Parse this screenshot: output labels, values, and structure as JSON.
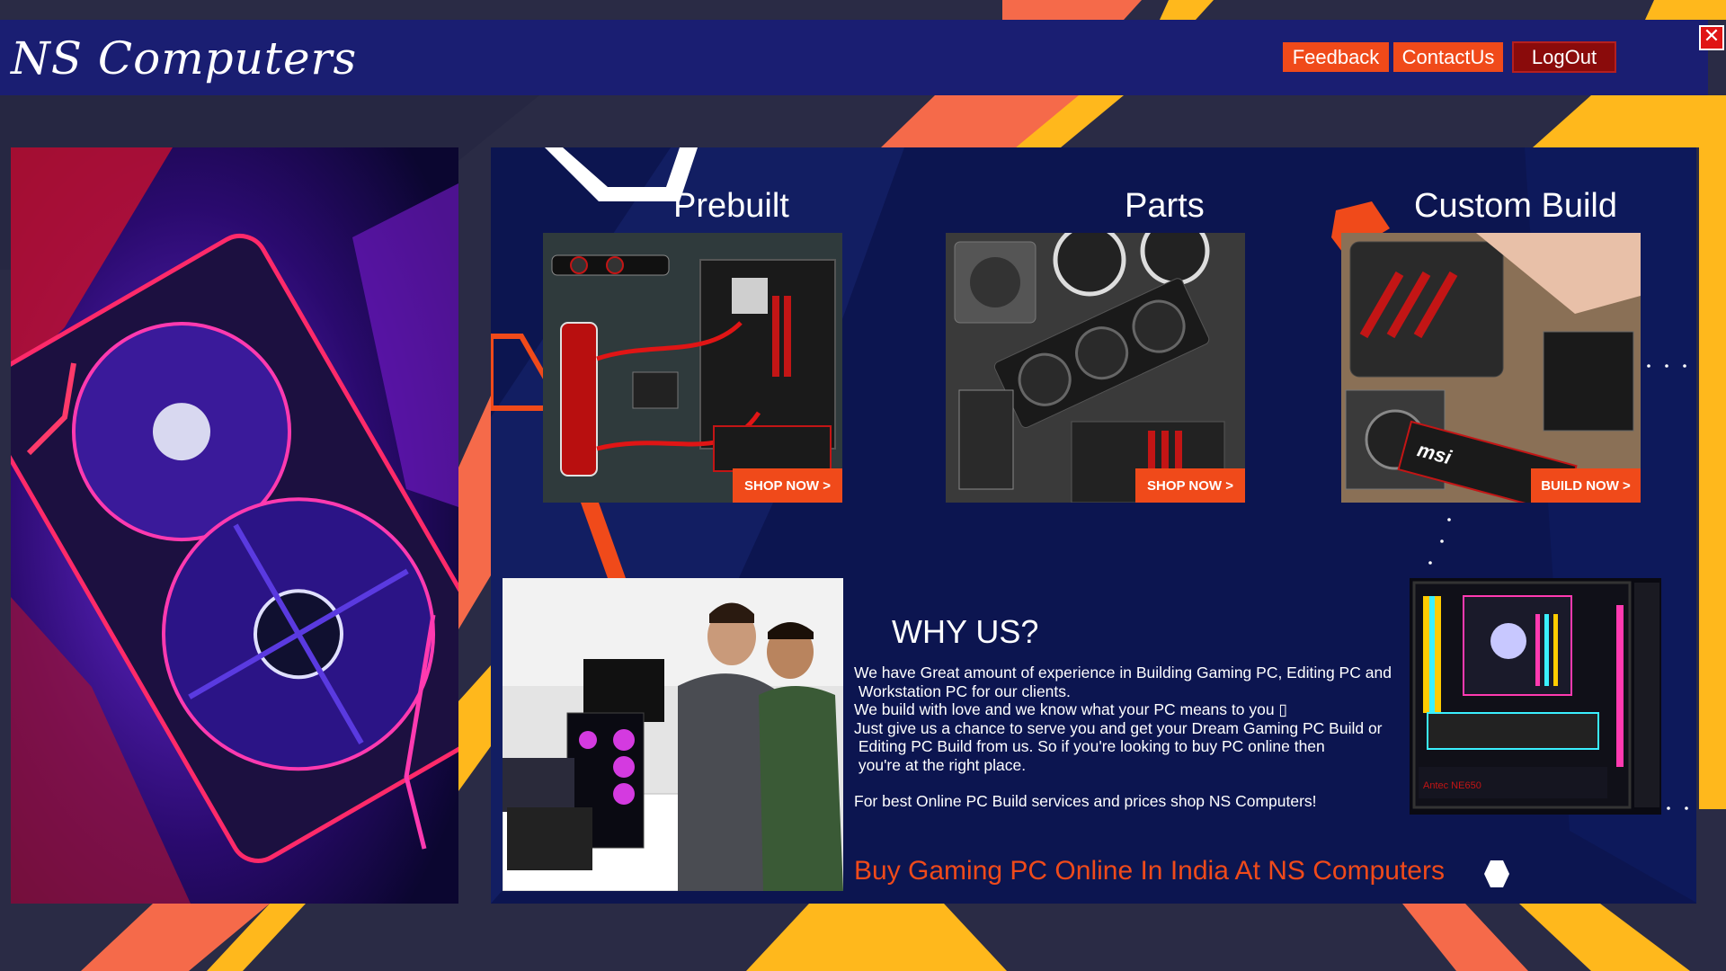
{
  "header": {
    "title": "NS Computers",
    "buttons": {
      "feedback": "Feedback",
      "contact": "ContactUs",
      "logout": "LogOut"
    },
    "close_symbol": "✕"
  },
  "categories": [
    {
      "title": "Prebuilt",
      "button": "SHOP NOW >"
    },
    {
      "title": "Parts",
      "button": "SHOP NOW >"
    },
    {
      "title": "Custom Build",
      "button": "BUILD NOW >"
    }
  ],
  "why_us": {
    "title": "WHY US?",
    "paragraphs": [
      "We have Great amount of experience in Building Gaming PC, Editing PC and\n Workstation PC for our clients.",
      "We build with love and we know what your PC means to you ▯",
      "Just give us a chance to serve you and get your Dream Gaming PC Build or\n Editing PC Build from us. So if you're looking to buy PC online then\n you're at the right place.",
      "For best Online PC Build services and prices shop NS Computers!"
    ],
    "tagline": "Buy Gaming PC Online In India At NS Computers"
  },
  "colors": {
    "header_bg": "#1a1e72",
    "accent_orange": "#f04a1a",
    "accent_yellow": "#ffb81c",
    "panel_bg": "#0c1550",
    "logout_bg": "#8a0b0b"
  },
  "icons": [
    "close-icon",
    "hexagon-icon"
  ]
}
